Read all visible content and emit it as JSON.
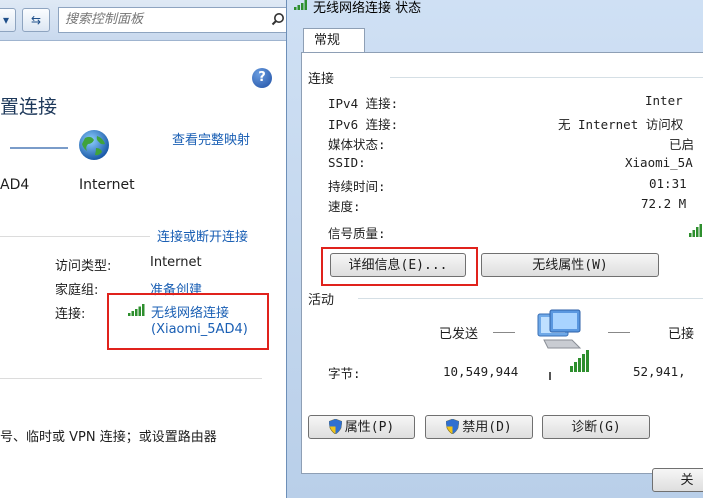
{
  "left_window": {
    "search_placeholder": "搜索控制面板",
    "heading": "置连接",
    "view_full_map": "查看完整映射",
    "network_name": "AD4",
    "internet": "Internet",
    "connect_disconnect": "连接或断开连接",
    "access_type_label": "访问类型:",
    "access_type_value": "Internet",
    "homegroup_label": "家庭组:",
    "homegroup_value": "准备创建",
    "connection_label": "连接:",
    "connection_name": "无线网络连接",
    "connection_ssid": "(Xiaomi_5AD4)",
    "bottom_text": "号、临时或 VPN 连接；或设置路由器"
  },
  "dialog": {
    "title": "无线网络连接 状态",
    "tab": "常规",
    "section_connection": "连接",
    "ipv4_label": "IPv4 连接:",
    "ipv4_value": "Inter",
    "ipv6_label": "IPv6 连接:",
    "ipv6_value": "无 Internet 访问权",
    "media_label": "媒体状态:",
    "media_value": "已启",
    "ssid_label": "SSID:",
    "ssid_value": "Xiaomi_5A",
    "duration_label": "持续时间:",
    "duration_value": "01:31",
    "speed_label": "速度:",
    "speed_value": "72.2 M",
    "signal_label": "信号质量:",
    "details_button": "详细信息(E)...",
    "wireless_props_button": "无线属性(W)",
    "section_activity": "活动",
    "sent_label": "已发送",
    "received_label": "已接",
    "bytes_label": "字节:",
    "bytes_sent": "10,549,944",
    "bytes_received": "52,941,",
    "properties_button": "属性(P)",
    "disable_button": "禁用(D)",
    "diagnose_button": "诊断(G)",
    "close_button": "关"
  }
}
